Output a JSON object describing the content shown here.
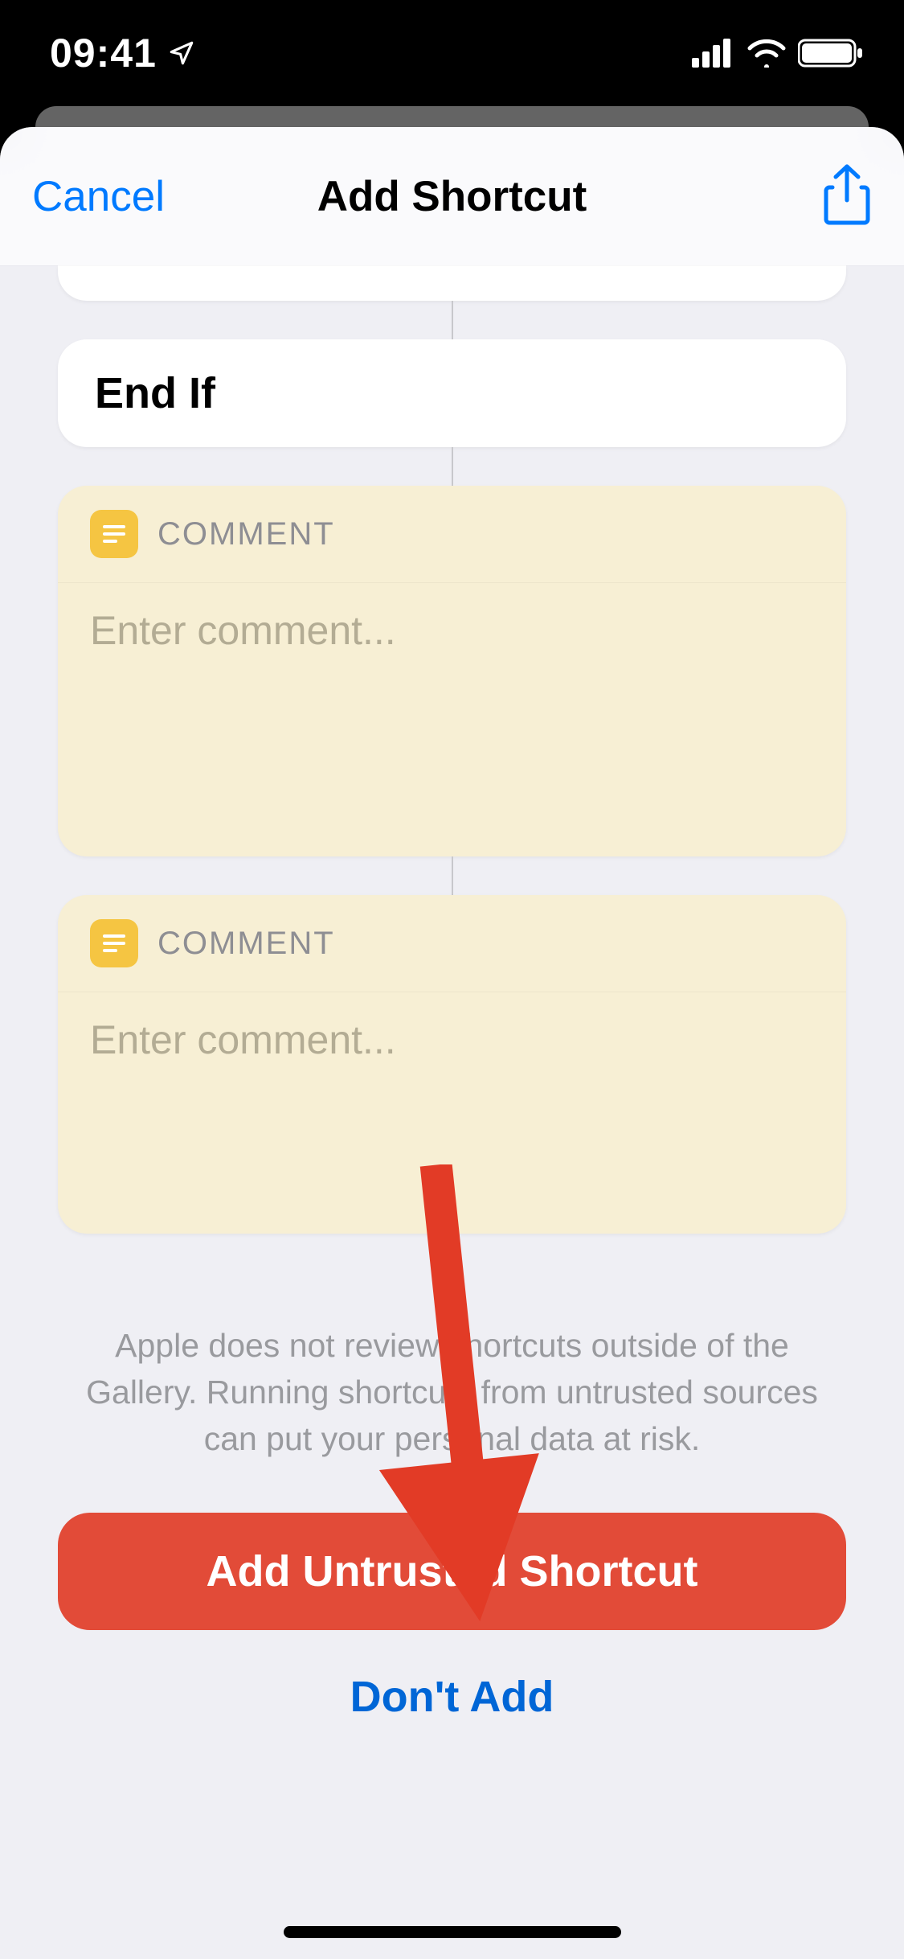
{
  "status": {
    "time": "09:41"
  },
  "header": {
    "cancel_label": "Cancel",
    "title": "Add Shortcut"
  },
  "workflow": {
    "endif_label": "End If",
    "comment_label": "COMMENT",
    "comment_placeholder": "Enter comment..."
  },
  "footer": {
    "warning_text": "Apple does not review shortcuts outside of the Gallery. Running shortcuts from untrusted sources can put your personal data at risk.",
    "add_button_label": "Add Untrusted Shortcut",
    "dont_add_label": "Don't Add"
  }
}
